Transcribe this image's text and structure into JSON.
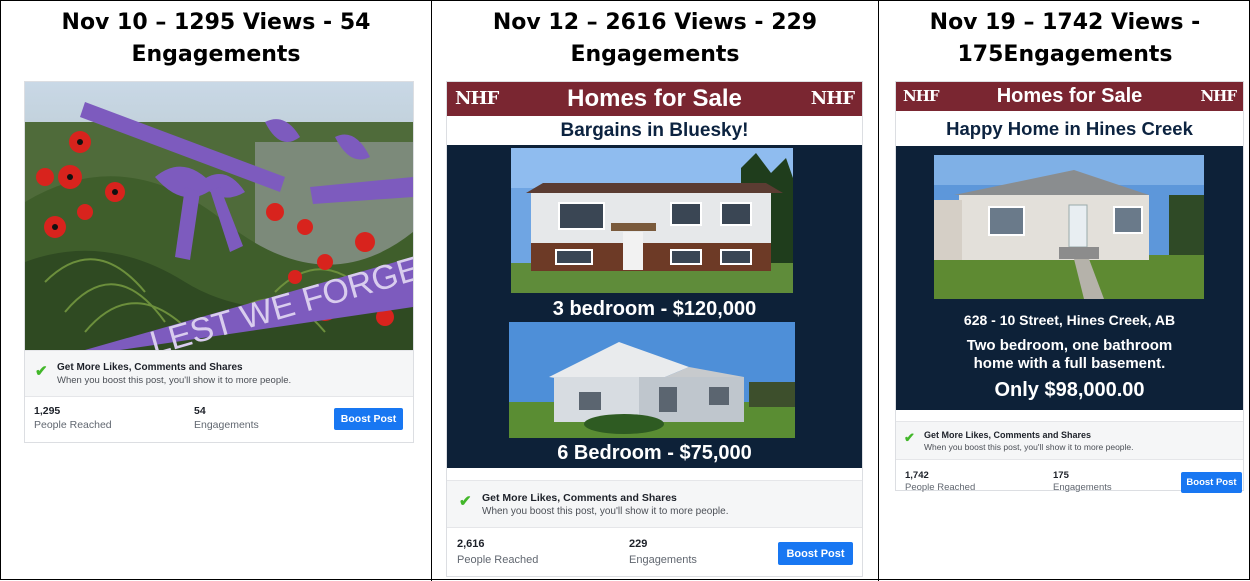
{
  "panels": [
    {
      "heading_line1": "Nov 10 – 1295 Views - 54",
      "heading_line2": "Engagements",
      "image_text": "LEST WE FORGET",
      "promo_title": "Get More Likes, Comments and Shares",
      "promo_sub": "When you boost this post, you'll show it to more people.",
      "reached_value": "1,295",
      "reached_label": "People Reached",
      "engagements_value": "54",
      "engagements_label": "Engagements",
      "boost_label": "Boost Post"
    },
    {
      "heading_line1": "Nov 12 – 2616 Views - 229",
      "heading_line2": "Engagements",
      "banner_title": "Homes for Sale",
      "logo_text": "NHF",
      "subhead": "Bargains in Bluesky!",
      "caption1": "3 bedroom - $120,000",
      "caption2": "6 Bedroom - $75,000",
      "promo_title": "Get More Likes, Comments and Shares",
      "promo_sub": "When you boost this post, you'll show it to more people.",
      "reached_value": "2,616",
      "reached_label": "People Reached",
      "engagements_value": "229",
      "engagements_label": "Engagements",
      "boost_label": "Boost Post"
    },
    {
      "heading_line1": "Nov 19 – 1742 Views -",
      "heading_line2": "175Engagements",
      "banner_title": "Homes for Sale",
      "logo_text": "NHF",
      "subhead": "Happy Home in Hines Creek",
      "address": "628 - 10 Street, Hines Creek, AB",
      "desc_line1": "Two bedroom, one bathroom",
      "desc_line2": "home with a full basement.",
      "price": "Only $98,000.00",
      "promo_title": "Get More Likes, Comments and Shares",
      "promo_sub": "When you boost this post, you'll show it to more people.",
      "reached_value": "1,742",
      "reached_label": "People Reached",
      "engagements_value": "175",
      "engagements_label": "Engagements",
      "boost_label": "Boost Post"
    }
  ],
  "colors": {
    "banner": "#7a2631",
    "navy": "#0d2138",
    "boost": "#1877f2",
    "check": "#42b72a",
    "ribbon": "#7d5bbe",
    "poppy": "#d8231d"
  },
  "icons": [
    "check-icon",
    "house-logo-icon"
  ]
}
